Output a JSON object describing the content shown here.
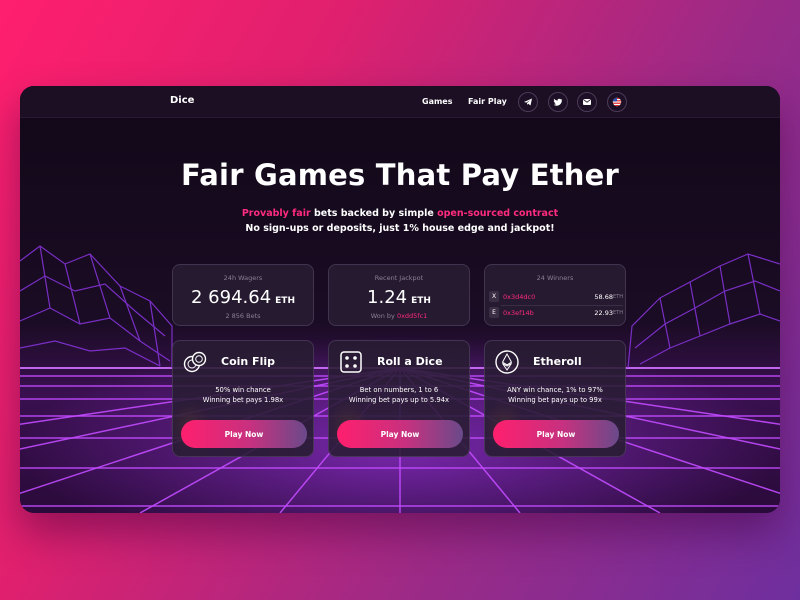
{
  "brand": "Dice",
  "nav": {
    "games": "Games",
    "fair_play": "Fair Play"
  },
  "social": [
    "telegram-icon",
    "twitter-icon",
    "mail-icon",
    "us-flag-icon"
  ],
  "hero": {
    "title": "Fair Games That Pay Ether",
    "line1_a": "Provably fair",
    "line1_b": " bets backed by simple ",
    "line1_c": "open-sourced contract",
    "line2": "No sign-ups or deposits, just 1% house edge and jackpot!"
  },
  "stats": {
    "wagers": {
      "label": "24h Wagers",
      "value": "2 694.64",
      "unit": "ETH",
      "sub": "2 856 Bets"
    },
    "jackpot": {
      "label": "Recent Jackpot",
      "value": "1.24",
      "unit": "ETH",
      "sub_prefix": "Won by ",
      "sub_addr": "0xdd5fc1"
    },
    "winners": {
      "label": "24 Winners",
      "rows": [
        {
          "badge": "X",
          "addr": "0x3d4dc0",
          "amount": "58.68",
          "unit": "ETH"
        },
        {
          "badge": "E",
          "addr": "0x3ef14b",
          "amount": "22.93",
          "unit": "ETH"
        }
      ]
    }
  },
  "games": [
    {
      "title": "Coin Flip",
      "line1": "50% win chance",
      "line2": "Winning bet pays 1.98x",
      "button": "Play Now",
      "icon": "coins-icon"
    },
    {
      "title": "Roll a Dice",
      "line1": "Bet on numbers, 1 to 6",
      "line2": "Winning bet pays up to 5.94x",
      "button": "Play Now",
      "icon": "dice-icon"
    },
    {
      "title": "Etheroll",
      "line1": "ANY win chance, 1% to 97%",
      "line2": "Winning bet pays up to 99x",
      "button": "Play Now",
      "icon": "ethereum-icon"
    }
  ],
  "colors": {
    "accent": "#ff2b7e",
    "background": "#150a1f",
    "neon": "#c24bff"
  }
}
